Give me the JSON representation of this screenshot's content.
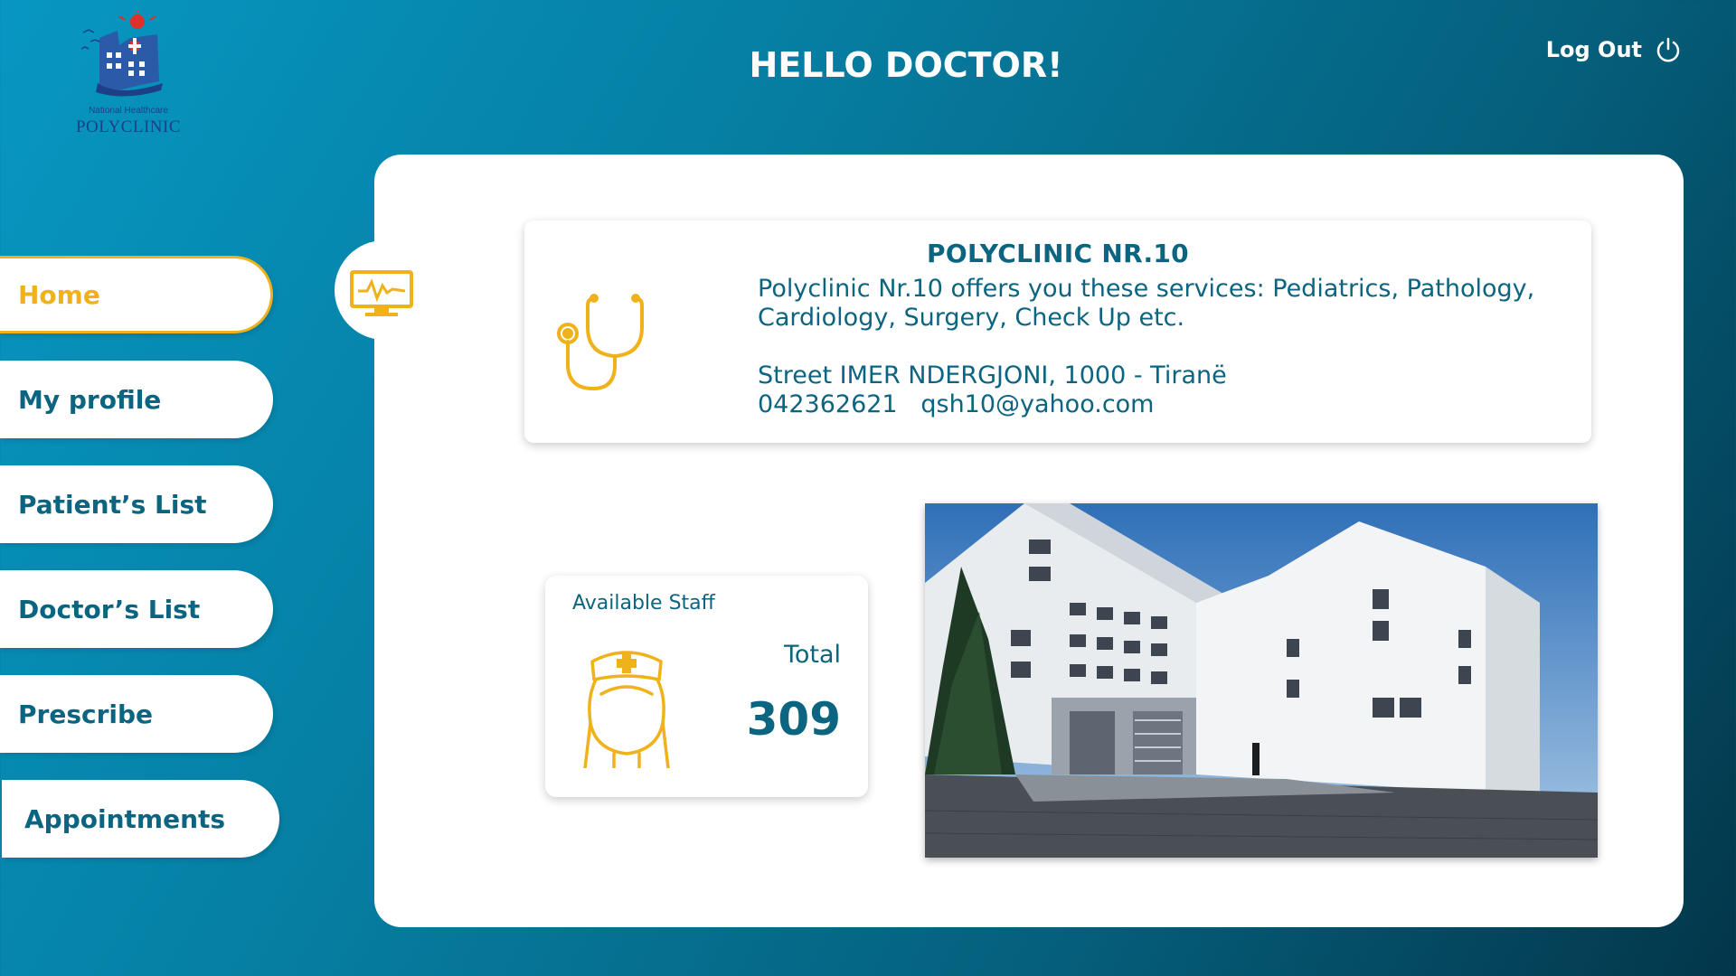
{
  "header": {
    "logo_small": "National Healthcare",
    "logo_big": "POLYCLINIC",
    "greeting": "HELLO DOCTOR!",
    "logout_label": "Log Out"
  },
  "sidebar": {
    "items": [
      {
        "label": "Home",
        "active": true
      },
      {
        "label": "My profile",
        "active": false
      },
      {
        "label": "Patient’s List",
        "active": false
      },
      {
        "label": "Doctor’s List",
        "active": false
      },
      {
        "label": "Prescribe",
        "active": false
      },
      {
        "label": "Appointments",
        "active": false
      }
    ]
  },
  "info_card": {
    "title": "POLYCLINIC NR.10",
    "description_line1": "Polyclinic Nr.10 offers you these services: Pediatrics, Pathology,",
    "description_line2": "Cardiology, Surgery, Check Up etc.",
    "address": "Street IMER NDERGJONI, 1000 - Tiranë",
    "phone": "042362621",
    "email": "qsh10@yahoo.com"
  },
  "staff_card": {
    "label": "Available Staff",
    "total_label": "Total",
    "total_value": "309"
  },
  "colors": {
    "accent": "#f0b21b",
    "primary_text": "#0b6480",
    "background_start": "#0797c2",
    "background_end": "#03364a"
  },
  "icons": [
    "polyclinic-logo-icon",
    "power-icon",
    "monitor-icon",
    "stethoscope-icon",
    "nurse-icon"
  ]
}
